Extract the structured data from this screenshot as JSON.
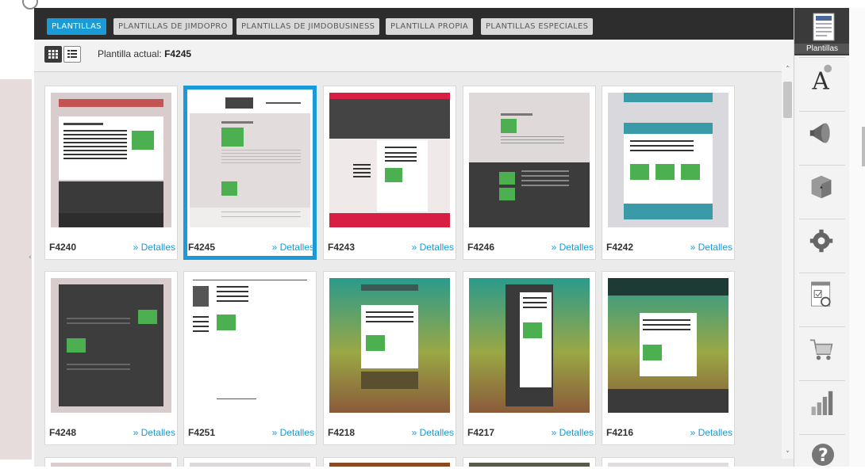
{
  "tabs": [
    {
      "label": "PLANTILLAS",
      "active": true
    },
    {
      "label": "PLANTILLAS DE JIMDOPRO",
      "active": false
    },
    {
      "label": "PLANTILLAS DE JIMDOBUSINESS",
      "active": false
    },
    {
      "label": "PLANTILLA PROPIA",
      "active": false
    },
    {
      "label": "PLANTILLAS ESPECIALES",
      "active": false
    }
  ],
  "toolbar": {
    "view_modes": [
      "grid-view-icon",
      "list-view-icon"
    ],
    "current_label": "Plantilla actual:",
    "current_value": "F4245"
  },
  "templates": [
    {
      "name": "F4240",
      "link": "» Detalles",
      "selected": false
    },
    {
      "name": "F4245",
      "link": "» Detalles",
      "selected": true
    },
    {
      "name": "F4243",
      "link": "» Detalles",
      "selected": false
    },
    {
      "name": "F4246",
      "link": "» Detalles",
      "selected": false
    },
    {
      "name": "F4242",
      "link": "» Detalles",
      "selected": false
    },
    {
      "name": "F4248",
      "link": "» Detalles",
      "selected": false
    },
    {
      "name": "F4251",
      "link": "» Detalles",
      "selected": false
    },
    {
      "name": "F4218",
      "link": "» Detalles",
      "selected": false
    },
    {
      "name": "F4217",
      "link": "» Detalles",
      "selected": false
    },
    {
      "name": "F4216",
      "link": "» Detalles",
      "selected": false
    }
  ],
  "sidebar": {
    "items": [
      {
        "icon": "templates-icon",
        "label": "Plantillas",
        "active": true
      },
      {
        "icon": "font-style-icon"
      },
      {
        "icon": "megaphone-icon"
      },
      {
        "icon": "package-icon"
      },
      {
        "icon": "gear-icon"
      },
      {
        "icon": "statistics-page-icon"
      },
      {
        "icon": "shopping-cart-icon"
      },
      {
        "icon": "bar-chart-icon"
      },
      {
        "icon": "help-icon"
      }
    ]
  },
  "colors": {
    "accent": "#1a9ad6",
    "tabbar": "#2d2d2d",
    "panel": "#ebebeb"
  }
}
